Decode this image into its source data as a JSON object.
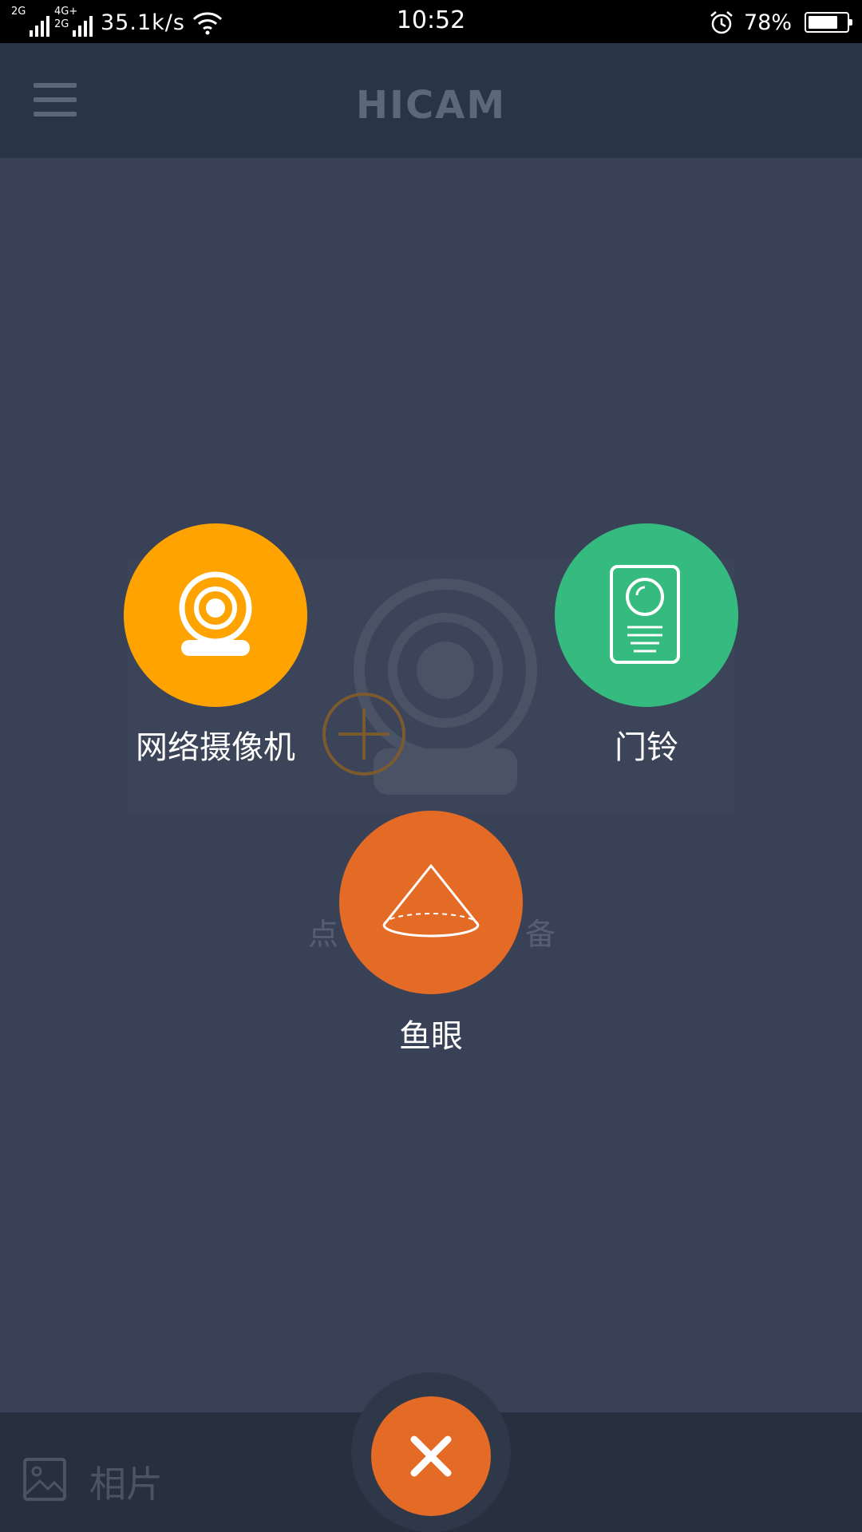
{
  "status_bar": {
    "sim1_label": "2G",
    "sim2_label_top": "4G+",
    "sim2_label_bottom": "2G",
    "net_speed": "35.1k/s",
    "time": "10:52",
    "battery_percent": "78%",
    "battery_level": 0.78,
    "icons": [
      "signal-icon",
      "wifi-icon",
      "alarm-icon",
      "battery-icon"
    ]
  },
  "app_bar": {
    "title": "HICAM",
    "menu_icon": "menu-icon"
  },
  "background": {
    "hint_left": "点",
    "hint_right": "备"
  },
  "options": {
    "camera": {
      "label": "网络摄像机",
      "color": "#fea300",
      "icon": "webcam-icon"
    },
    "doorbell": {
      "label": "门铃",
      "color": "#35bb7f",
      "icon": "doorbell-icon"
    },
    "fisheye": {
      "label": "鱼眼",
      "color": "#e46b26",
      "icon": "fisheye-icon"
    }
  },
  "bottom_bar": {
    "photos_label": "相片",
    "photos_icon": "image-icon",
    "close_icon": "close-icon",
    "close_color": "#e46b26"
  }
}
